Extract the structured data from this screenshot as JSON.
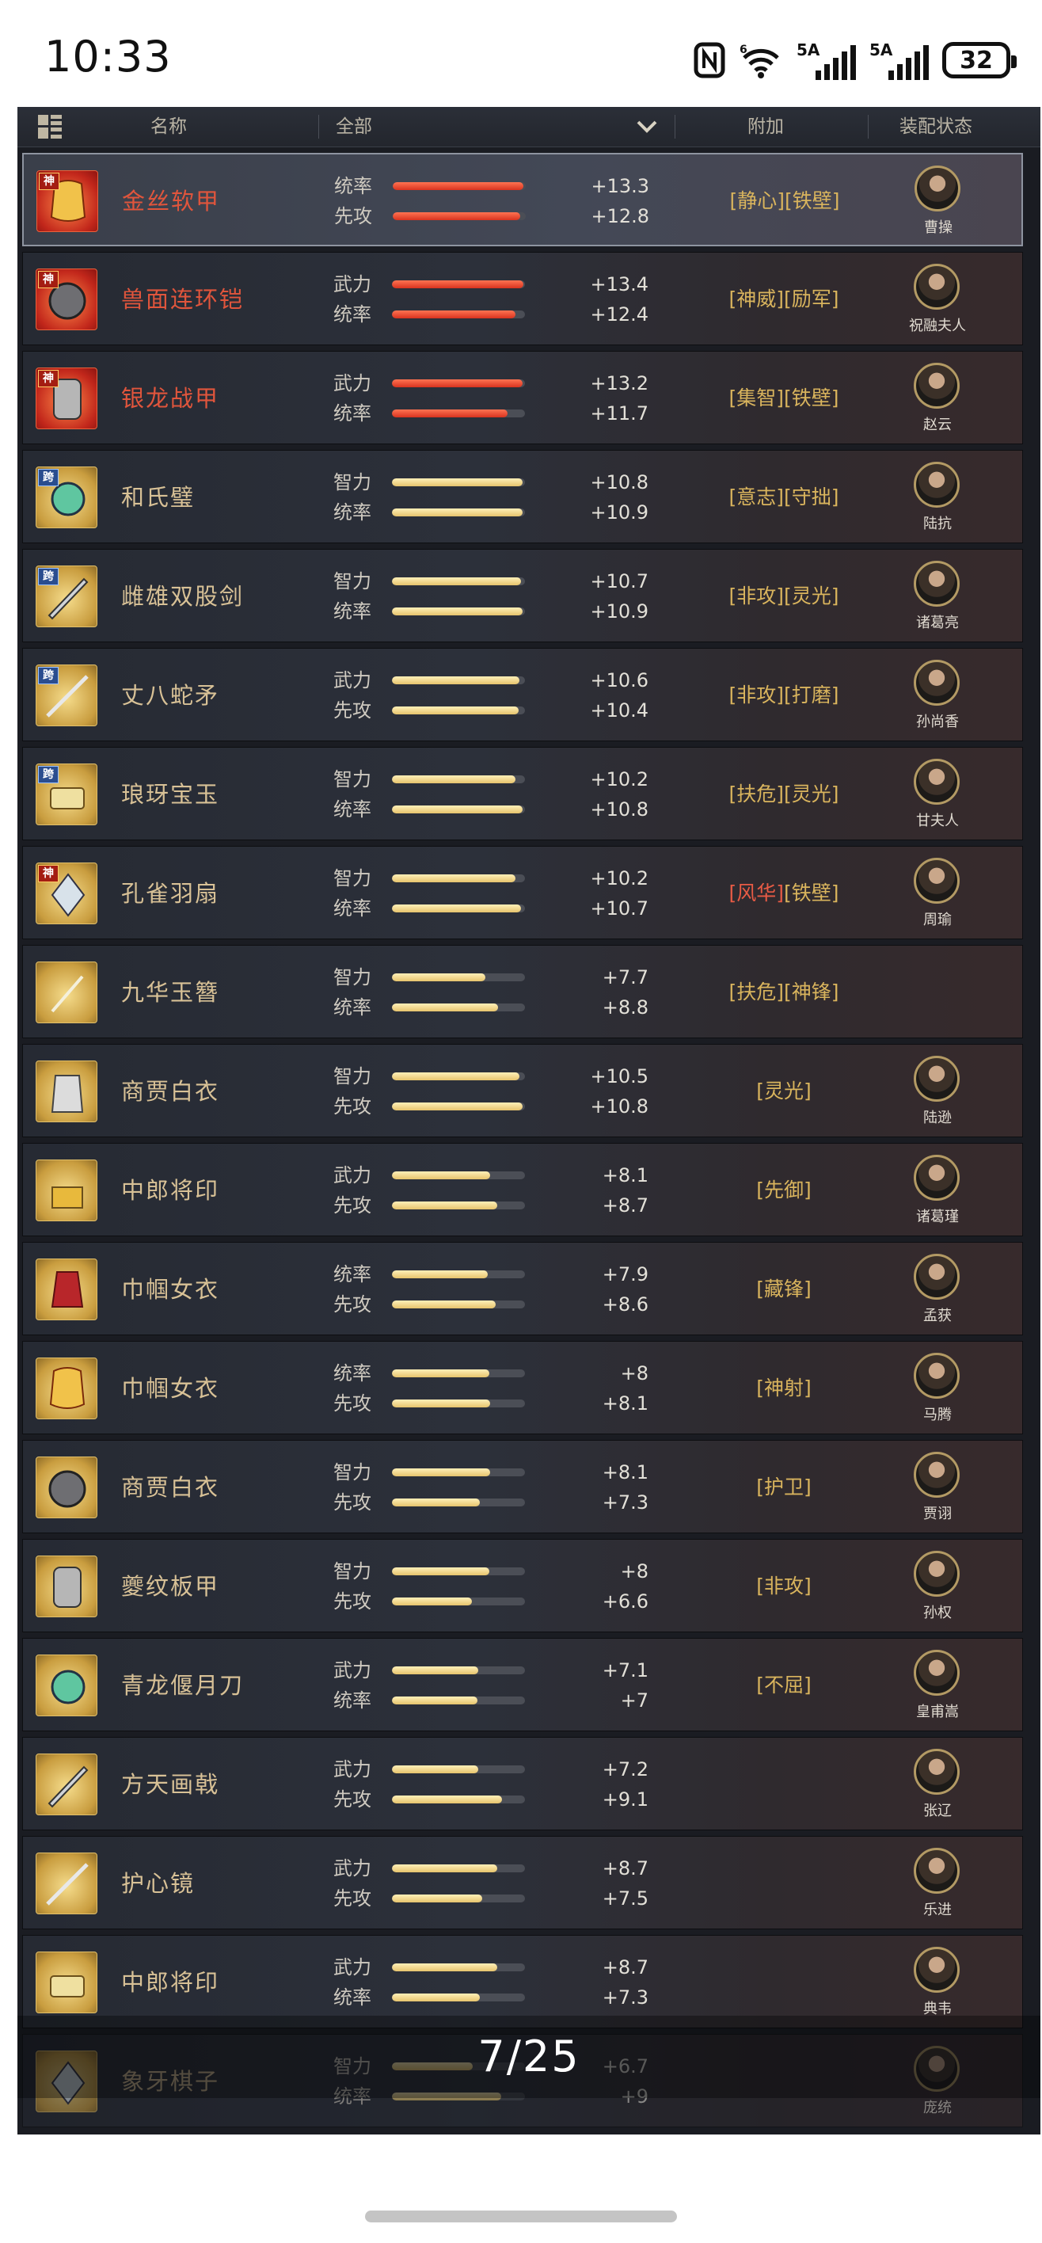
{
  "status_bar": {
    "time": "10:33",
    "battery": "32",
    "sim1": "5A",
    "sim2": "5A"
  },
  "header": {
    "col_name": "名称",
    "col_filter": "全部",
    "col_extra": "附加",
    "col_equip": "装配状态"
  },
  "items": [
    {
      "name": "金丝软甲",
      "rarity": "red",
      "tag": "神",
      "stats": [
        {
          "label": "统率",
          "value": "+13.3",
          "level": 0.98
        },
        {
          "label": "先攻",
          "value": "+12.8",
          "level": 0.96
        }
      ],
      "extra": [
        {
          "text": "[静心]",
          "color": "gold"
        },
        {
          "text": "[铁壁]",
          "color": "gold"
        }
      ],
      "general": "曹操",
      "selected": true
    },
    {
      "name": "兽面连环铠",
      "rarity": "red",
      "tag": "神",
      "stats": [
        {
          "label": "武力",
          "value": "+13.4",
          "level": 0.99
        },
        {
          "label": "统率",
          "value": "+12.4",
          "level": 0.93
        }
      ],
      "extra": [
        {
          "text": "[神威]",
          "color": "gold"
        },
        {
          "text": "[励军]",
          "color": "gold"
        }
      ],
      "general": "祝融夫人"
    },
    {
      "name": "银龙战甲",
      "rarity": "red",
      "tag": "神",
      "stats": [
        {
          "label": "武力",
          "value": "+13.2",
          "level": 0.98
        },
        {
          "label": "统率",
          "value": "+11.7",
          "level": 0.87
        }
      ],
      "extra": [
        {
          "text": "[集智]",
          "color": "gold"
        },
        {
          "text": "[铁壁]",
          "color": "gold"
        }
      ],
      "general": "赵云"
    },
    {
      "name": "和氏璧",
      "rarity": "gold",
      "tag": "跨",
      "stats": [
        {
          "label": "智力",
          "value": "+10.8",
          "level": 0.98
        },
        {
          "label": "统率",
          "value": "+10.9",
          "level": 0.98
        }
      ],
      "extra": [
        {
          "text": "[意志]",
          "color": "gold"
        },
        {
          "text": "[守拙]",
          "color": "gold"
        }
      ],
      "general": "陆抗"
    },
    {
      "name": "雌雄双股剑",
      "rarity": "gold",
      "tag": "跨",
      "stats": [
        {
          "label": "智力",
          "value": "+10.7",
          "level": 0.97
        },
        {
          "label": "统率",
          "value": "+10.9",
          "level": 0.98
        }
      ],
      "extra": [
        {
          "text": "[非攻]",
          "color": "gold"
        },
        {
          "text": "[灵光]",
          "color": "gold"
        }
      ],
      "general": "诸葛亮"
    },
    {
      "name": "丈八蛇矛",
      "rarity": "gold",
      "tag": "跨",
      "stats": [
        {
          "label": "武力",
          "value": "+10.6",
          "level": 0.96
        },
        {
          "label": "先攻",
          "value": "+10.4",
          "level": 0.95
        }
      ],
      "extra": [
        {
          "text": "[非攻]",
          "color": "gold"
        },
        {
          "text": "[打磨]",
          "color": "gold"
        }
      ],
      "general": "孙尚香"
    },
    {
      "name": "琅玡宝玉",
      "rarity": "gold",
      "tag": "跨",
      "stats": [
        {
          "label": "智力",
          "value": "+10.2",
          "level": 0.93
        },
        {
          "label": "统率",
          "value": "+10.8",
          "level": 0.98
        }
      ],
      "extra": [
        {
          "text": "[扶危]",
          "color": "gold"
        },
        {
          "text": "[灵光]",
          "color": "gold"
        }
      ],
      "general": "甘夫人"
    },
    {
      "name": "孔雀羽扇",
      "rarity": "gold",
      "tag": "神",
      "stats": [
        {
          "label": "智力",
          "value": "+10.2",
          "level": 0.93
        },
        {
          "label": "统率",
          "value": "+10.7",
          "level": 0.97
        }
      ],
      "extra": [
        {
          "text": "[风华]",
          "color": "red"
        },
        {
          "text": "[铁壁]",
          "color": "gold"
        }
      ],
      "general": "周瑜"
    },
    {
      "name": "九华玉簪",
      "rarity": "gold",
      "tag": "",
      "stats": [
        {
          "label": "智力",
          "value": "+7.7",
          "level": 0.7
        },
        {
          "label": "统率",
          "value": "+8.8",
          "level": 0.8
        }
      ],
      "extra": [
        {
          "text": "[扶危]",
          "color": "gold"
        },
        {
          "text": "[神锋]",
          "color": "gold"
        }
      ],
      "general": ""
    },
    {
      "name": "商贾白衣",
      "rarity": "gold",
      "tag": "",
      "stats": [
        {
          "label": "智力",
          "value": "+10.5",
          "level": 0.96
        },
        {
          "label": "先攻",
          "value": "+10.8",
          "level": 0.98
        }
      ],
      "extra": [
        {
          "text": "[灵光]",
          "color": "gold"
        }
      ],
      "general": "陆逊"
    },
    {
      "name": "中郎将印",
      "rarity": "gold",
      "tag": "",
      "stats": [
        {
          "label": "武力",
          "value": "+8.1",
          "level": 0.74
        },
        {
          "label": "先攻",
          "value": "+8.7",
          "level": 0.79
        }
      ],
      "extra": [
        {
          "text": "[先御]",
          "color": "gold"
        }
      ],
      "general": "诸葛瑾"
    },
    {
      "name": "巾帼女衣",
      "rarity": "gold",
      "tag": "",
      "stats": [
        {
          "label": "统率",
          "value": "+7.9",
          "level": 0.72
        },
        {
          "label": "先攻",
          "value": "+8.6",
          "level": 0.78
        }
      ],
      "extra": [
        {
          "text": "[藏锋]",
          "color": "gold"
        }
      ],
      "general": "孟获"
    },
    {
      "name": "巾帼女衣",
      "rarity": "gold",
      "tag": "",
      "stats": [
        {
          "label": "统率",
          "value": "+8",
          "level": 0.73
        },
        {
          "label": "先攻",
          "value": "+8.1",
          "level": 0.74
        }
      ],
      "extra": [
        {
          "text": "[神射]",
          "color": "gold"
        }
      ],
      "general": "马腾"
    },
    {
      "name": "商贾白衣",
      "rarity": "gold",
      "tag": "",
      "stats": [
        {
          "label": "智力",
          "value": "+8.1",
          "level": 0.74
        },
        {
          "label": "先攻",
          "value": "+7.3",
          "level": 0.66
        }
      ],
      "extra": [
        {
          "text": "[护卫]",
          "color": "gold"
        }
      ],
      "general": "贾诩"
    },
    {
      "name": "夔纹板甲",
      "rarity": "gold",
      "tag": "",
      "stats": [
        {
          "label": "智力",
          "value": "+8",
          "level": 0.73
        },
        {
          "label": "先攻",
          "value": "+6.6",
          "level": 0.6
        }
      ],
      "extra": [
        {
          "text": "[非攻]",
          "color": "gold"
        }
      ],
      "general": "孙权"
    },
    {
      "name": "青龙偃月刀",
      "rarity": "gold",
      "tag": "",
      "stats": [
        {
          "label": "武力",
          "value": "+7.1",
          "level": 0.65
        },
        {
          "label": "统率",
          "value": "+7",
          "level": 0.64
        }
      ],
      "extra": [
        {
          "text": "[不屈]",
          "color": "gold"
        }
      ],
      "general": "皇甫嵩"
    },
    {
      "name": "方天画戟",
      "rarity": "gold",
      "tag": "",
      "stats": [
        {
          "label": "武力",
          "value": "+7.2",
          "level": 0.65
        },
        {
          "label": "先攻",
          "value": "+9.1",
          "level": 0.83
        }
      ],
      "extra": [],
      "general": "张辽"
    },
    {
      "name": "护心镜",
      "rarity": "gold",
      "tag": "",
      "stats": [
        {
          "label": "武力",
          "value": "+8.7",
          "level": 0.79
        },
        {
          "label": "先攻",
          "value": "+7.5",
          "level": 0.68
        }
      ],
      "extra": [],
      "general": "乐进"
    },
    {
      "name": "中郎将印",
      "rarity": "gold",
      "tag": "",
      "stats": [
        {
          "label": "武力",
          "value": "+8.7",
          "level": 0.79
        },
        {
          "label": "统率",
          "value": "+7.3",
          "level": 0.66
        }
      ],
      "extra": [],
      "general": "典韦"
    },
    {
      "name": "象牙棋子",
      "rarity": "gold",
      "tag": "",
      "stats": [
        {
          "label": "智力",
          "value": "+6.7",
          "level": 0.61
        },
        {
          "label": "统率",
          "value": "+9",
          "level": 0.82
        }
      ],
      "extra": [],
      "general": "庞统",
      "dimmed": true
    }
  ],
  "pager": {
    "text": "7/25"
  },
  "colors": {
    "accent_red": "#e0553c",
    "accent_gold": "#d9b45d",
    "panel": "#1a1c22"
  }
}
